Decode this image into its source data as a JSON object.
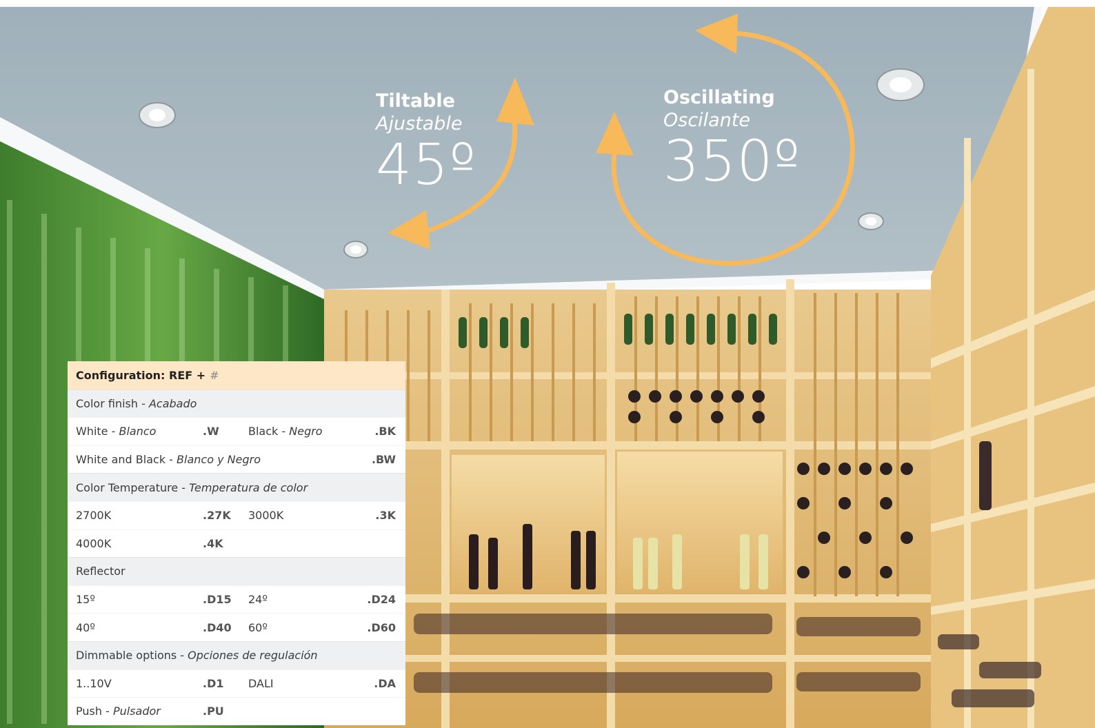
{
  "labels": {
    "tilt": {
      "title": "Tiltable",
      "subtitle": "Ajustable",
      "degrees": "45º"
    },
    "oscillate": {
      "title": "Oscillating",
      "subtitle": "Oscilante",
      "degrees": "350º"
    }
  },
  "colors": {
    "arrow": "#f8b95a",
    "ceiling": "#a8b7c0",
    "header_bg": "#fde7c6",
    "section_bg": "#eef0f2"
  },
  "config": {
    "heading": "Configuration: REF +",
    "heading_suffix": "#",
    "sections": [
      {
        "title": "Color finish",
        "title_es": "Acabado",
        "rows": [
          {
            "a": "White",
            "a_es": "Blanco",
            "a_code": ".W",
            "b": "Black",
            "b_es": "Negro",
            "b_code": ".BK"
          },
          {
            "a": "White and Black",
            "a_es": "Blanco y Negro",
            "a_code": "",
            "b": "",
            "b_es": "",
            "b_code": ".BW"
          }
        ]
      },
      {
        "title": "Color Temperature",
        "title_es": "Temperatura de color",
        "rows": [
          {
            "a": "2700K",
            "a_es": "",
            "a_code": ".27K",
            "b": "3000K",
            "b_es": "",
            "b_code": ".3K"
          },
          {
            "a": "4000K",
            "a_es": "",
            "a_code": ".4K",
            "b": "",
            "b_es": "",
            "b_code": ""
          }
        ]
      },
      {
        "title": "Reflector",
        "title_es": "",
        "rows": [
          {
            "a": "15º",
            "a_es": "",
            "a_code": ".D15",
            "b": "24º",
            "b_es": "",
            "b_code": ".D24"
          },
          {
            "a": "40º",
            "a_es": "",
            "a_code": ".D40",
            "b": "60º",
            "b_es": "",
            "b_code": ".D60"
          }
        ]
      },
      {
        "title": "Dimmable options",
        "title_es": "Opciones de regulación",
        "rows": [
          {
            "a": "1..10V",
            "a_es": "",
            "a_code": ".D1",
            "b": "DALI",
            "b_es": "",
            "b_code": ".DA"
          },
          {
            "a": "Push",
            "a_es": "Pulsador",
            "a_code": ".PU",
            "b": "",
            "b_es": "",
            "b_code": ""
          }
        ]
      }
    ]
  }
}
